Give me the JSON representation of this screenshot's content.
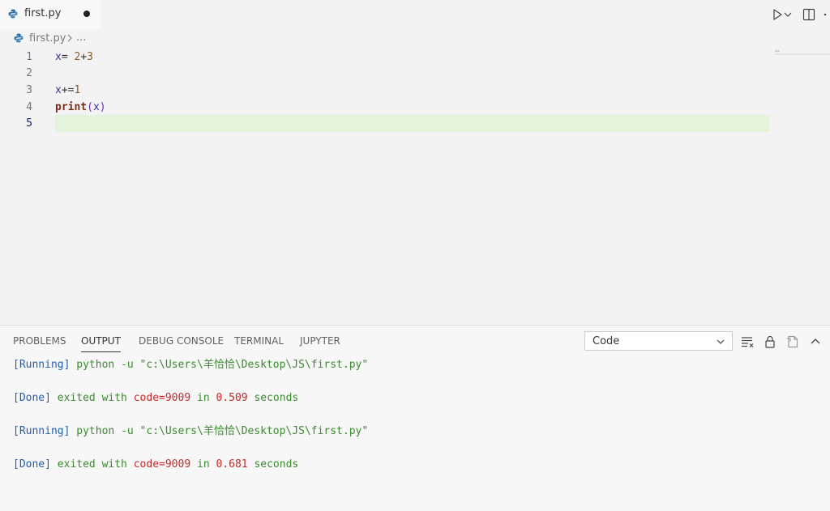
{
  "tab": {
    "file_name": "first.py"
  },
  "breadcrumb": {
    "file": "first.py",
    "ellipsis": "..."
  },
  "editor": {
    "line_numbers": [
      "1",
      "2",
      "3",
      "4",
      "5"
    ],
    "lines": {
      "l1": {
        "var": "x",
        "op": "= ",
        "num1": "2",
        "plus": "+",
        "num2": "3"
      },
      "l3": {
        "var": "x",
        "op": "+=",
        "num": "1"
      },
      "l4": {
        "fn": "print",
        "open": "(",
        "arg": "x",
        "close": ")"
      }
    }
  },
  "panel": {
    "tabs": [
      "PROBLEMS",
      "OUTPUT",
      "DEBUG CONSOLE",
      "TERMINAL",
      "JUPYTER"
    ],
    "active_tab": "OUTPUT",
    "select_value": "Code",
    "output": [
      {
        "tag": "[Running]",
        "cmd": " python -u ",
        "path": "\"c:\\Users\\羊恰恰\\Desktop\\JS\\first.py\""
      },
      {
        "tag": "[Done]",
        "text1": " exited with ",
        "code": "code=9009",
        "text2": " in ",
        "time": "0.509",
        "text3": " seconds"
      },
      {
        "tag": "[Running]",
        "cmd": " python -u ",
        "path": "\"c:\\Users\\羊恰恰\\Desktop\\JS\\first.py\""
      },
      {
        "tag": "[Done]",
        "text1": " exited with ",
        "code": "code=9009",
        "text2": " in ",
        "time": "0.681",
        "text3": " seconds"
      }
    ]
  },
  "icons": {
    "tab": "python-file-icon",
    "run": "run-icon",
    "run_dropdown": "chevron-down-icon",
    "split": "split-editor-icon",
    "more": "more-icon",
    "clear": "clear-output-icon",
    "lock": "lock-icon",
    "open_log": "open-log-icon",
    "maximize": "chevron-up-icon"
  },
  "colors": {
    "accent_line_highlight": "#e4f3dc",
    "running_tag": "#1f5fb3",
    "command": "#3b8a2f",
    "number": "#c62828"
  }
}
